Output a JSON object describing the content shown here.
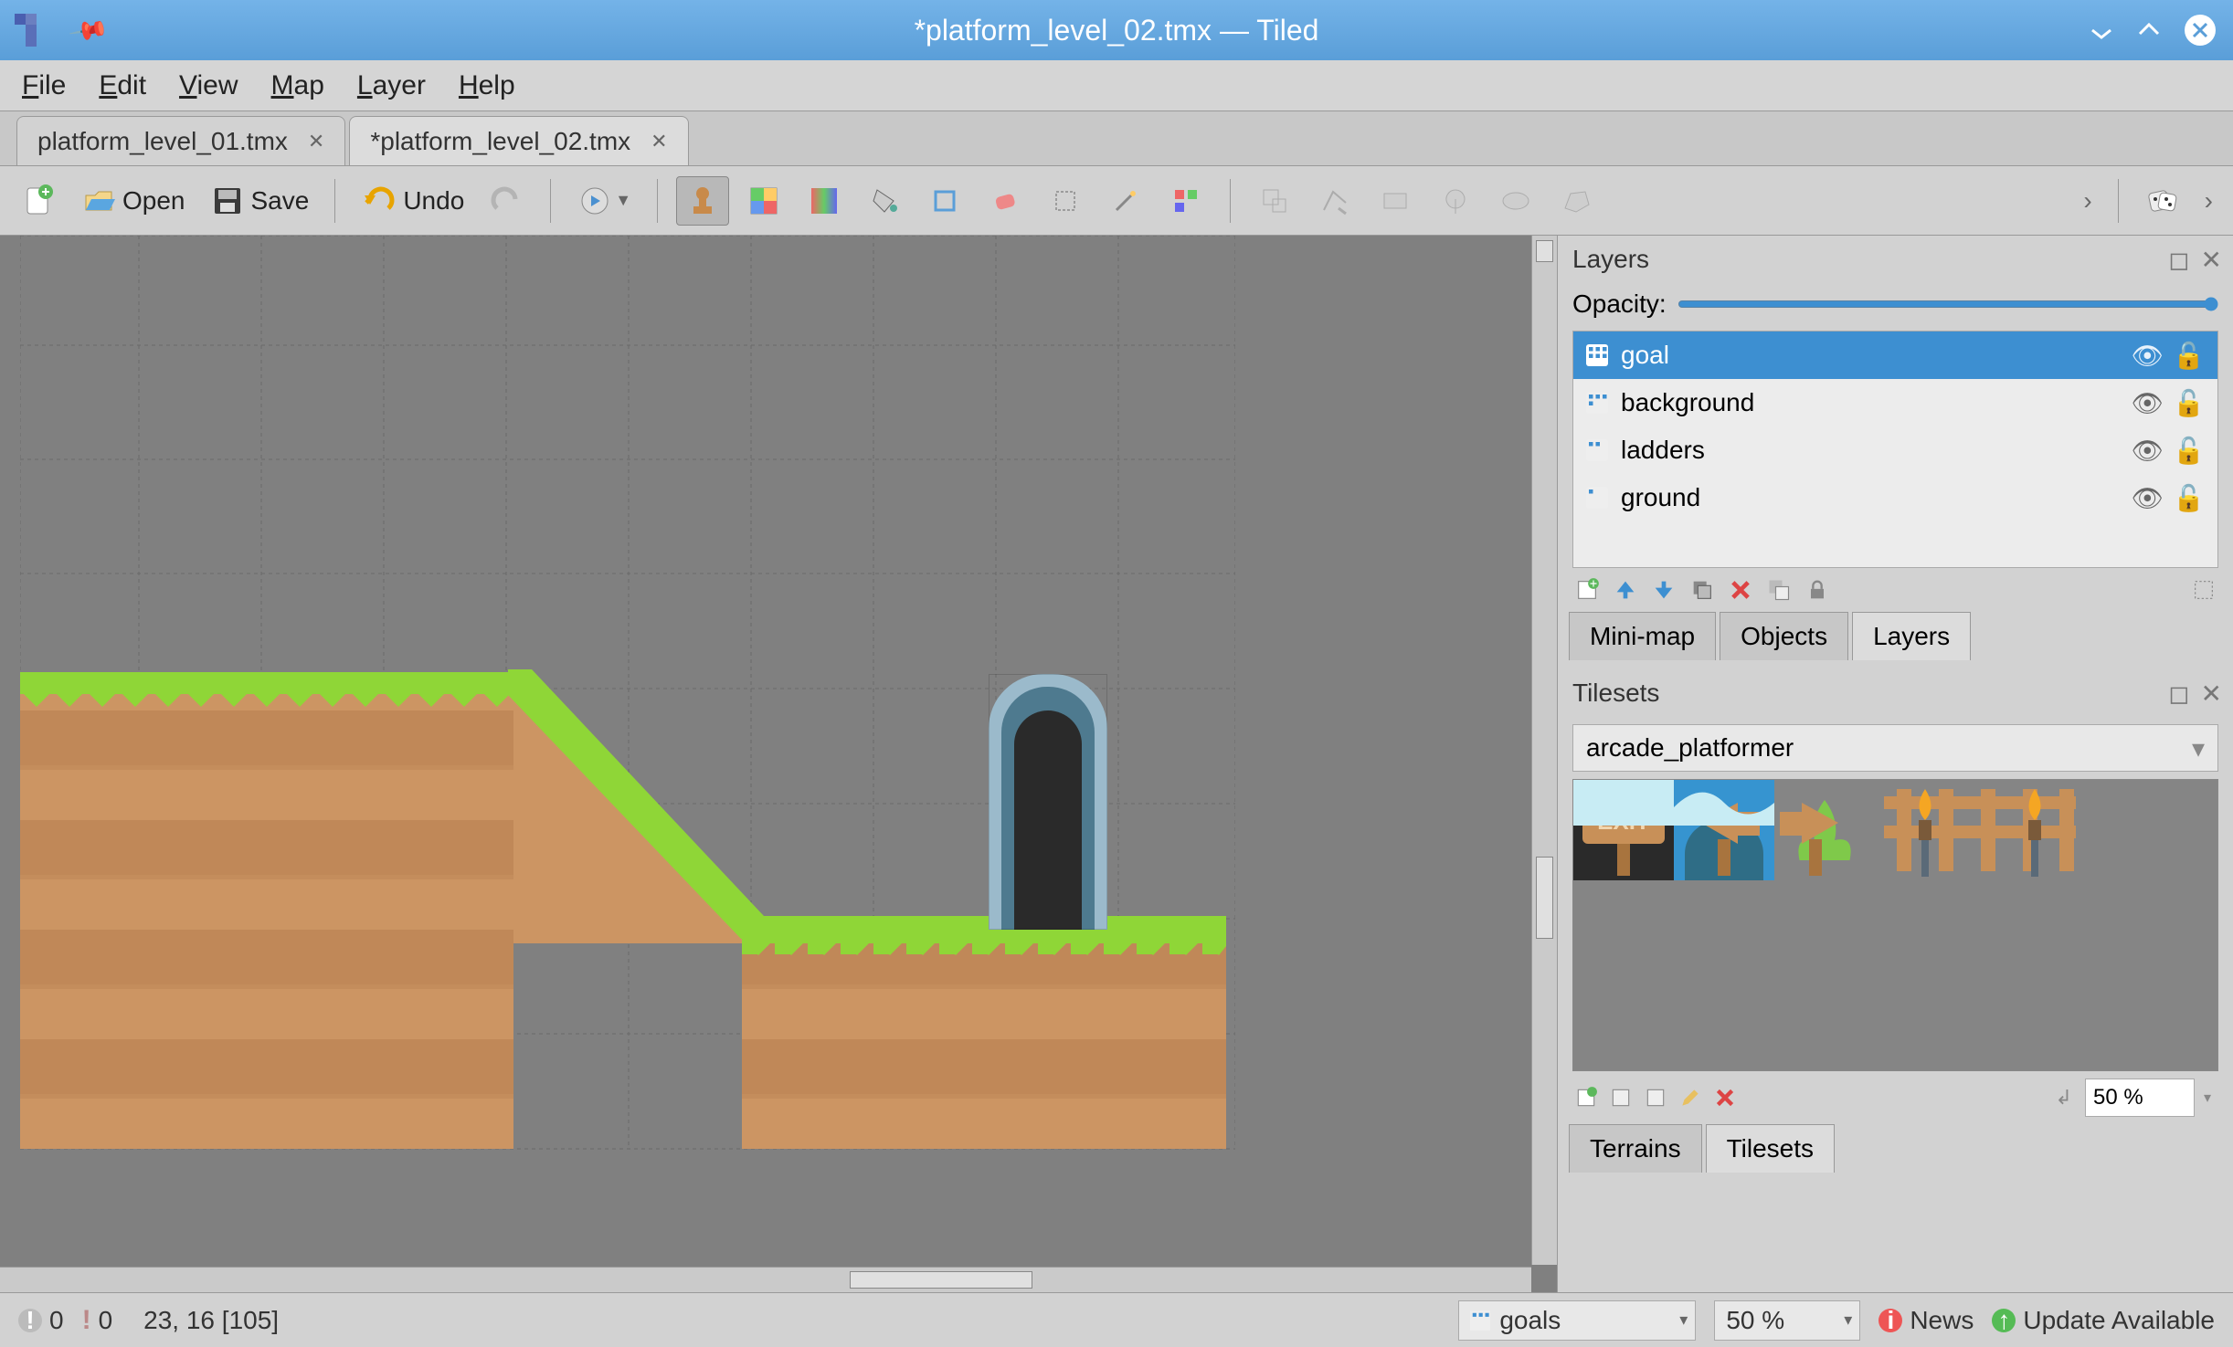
{
  "window": {
    "title": "*platform_level_02.tmx — Tiled"
  },
  "menubar": {
    "file": "File",
    "edit": "Edit",
    "view": "View",
    "map": "Map",
    "layer": "Layer",
    "help": "Help"
  },
  "tabs": [
    {
      "label": "platform_level_01.tmx",
      "active": false
    },
    {
      "label": "*platform_level_02.tmx",
      "active": true
    }
  ],
  "toolbar": {
    "open": "Open",
    "save": "Save",
    "undo": "Undo"
  },
  "layers_panel": {
    "title": "Layers",
    "opacity_label": "Opacity:",
    "layers": [
      {
        "name": "goal",
        "selected": true
      },
      {
        "name": "background",
        "selected": false
      },
      {
        "name": "ladders",
        "selected": false
      },
      {
        "name": "ground",
        "selected": false
      }
    ],
    "tabs": {
      "minimap": "Mini-map",
      "objects": "Objects",
      "layers": "Layers"
    }
  },
  "tilesets_panel": {
    "title": "Tilesets",
    "selected": "arcade_platformer",
    "zoom": "50 %",
    "tabs": {
      "terrains": "Terrains",
      "tilesets": "Tilesets"
    }
  },
  "statusbar": {
    "errors": "0",
    "warnings": "0",
    "coords": "23, 16 [105]",
    "layer_dropdown": "goals",
    "zoom": "50 %",
    "news": "News",
    "update": "Update Available"
  }
}
